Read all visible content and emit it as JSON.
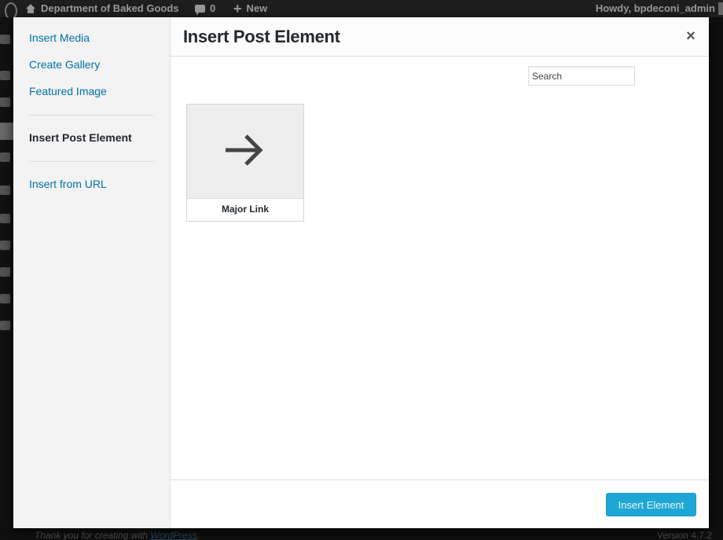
{
  "admin_bar": {
    "site_name": "Department of Baked Goods",
    "comment_count": "0",
    "new_label": "New",
    "greeting": "Howdy, bpdeconi_admin"
  },
  "footer": {
    "thanks_prefix": "Thank you for creating with ",
    "thanks_link": "WordPress",
    "thanks_suffix": ".",
    "version": "Version 4.7.2"
  },
  "modal": {
    "menu": {
      "items": [
        {
          "label": "Insert Media"
        },
        {
          "label": "Create Gallery"
        },
        {
          "label": "Featured Image"
        },
        {
          "label": "Insert Post Element",
          "current": true
        },
        {
          "label": "Insert from URL"
        }
      ]
    },
    "title": "Insert Post Element",
    "close_glyph": "×",
    "search": {
      "placeholder": "Search",
      "value": ""
    },
    "elements": [
      {
        "label": "Major Link",
        "icon": "arrow-right-icon"
      }
    ],
    "toolbar": {
      "insert_label": "Insert Element"
    }
  }
}
